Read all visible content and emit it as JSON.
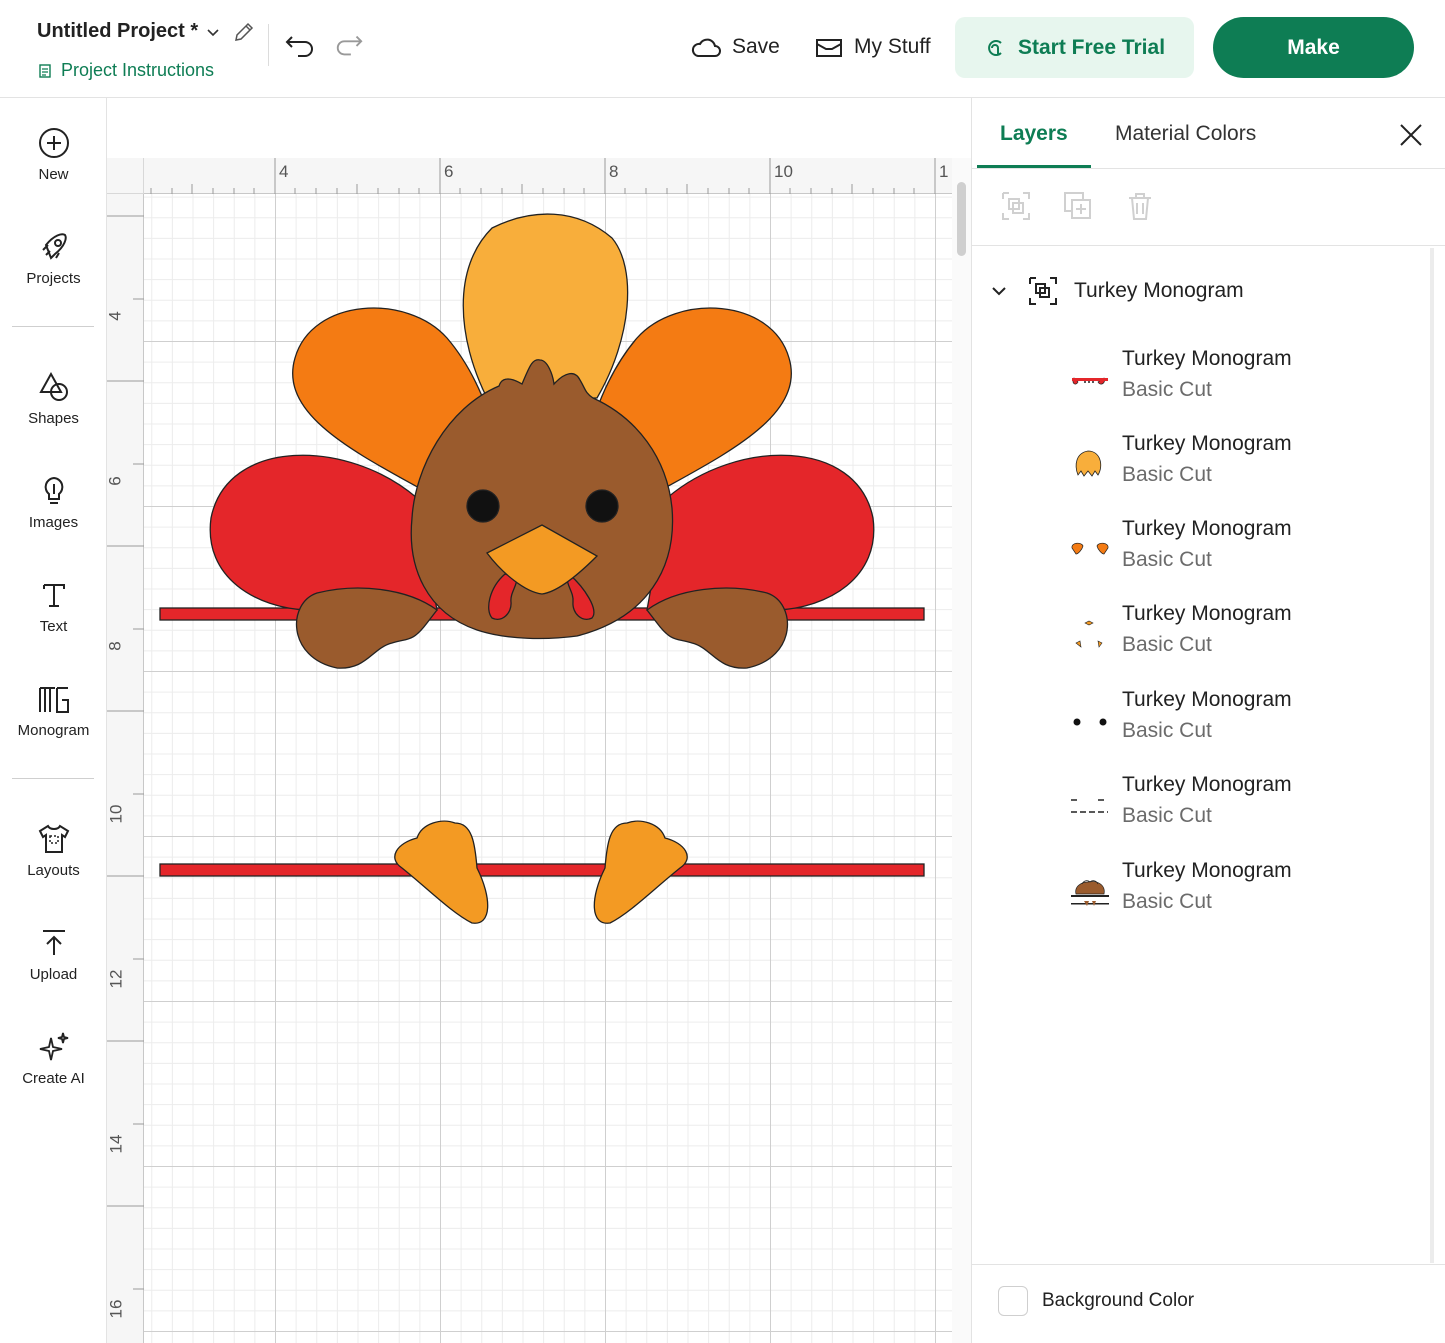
{
  "header": {
    "project_title": "Untitled Project *",
    "project_instructions": "Project Instructions",
    "save_label": "Save",
    "mystuff_label": "My Stuff",
    "trial_label": "Start Free Trial",
    "make_label": "Make"
  },
  "toolbar": {
    "items": [
      {
        "label": "New",
        "icon": "plus-circle-icon"
      },
      {
        "label": "Projects",
        "icon": "rocket-icon"
      },
      {
        "label": "Shapes",
        "icon": "shapes-icon"
      },
      {
        "label": "Images",
        "icon": "lightbulb-icon"
      },
      {
        "label": "Text",
        "icon": "text-icon"
      },
      {
        "label": "Monogram",
        "icon": "monogram-icon"
      },
      {
        "label": "Layouts",
        "icon": "tshirt-icon"
      },
      {
        "label": "Upload",
        "icon": "upload-icon"
      },
      {
        "label": "Create AI",
        "icon": "sparkle-icon"
      }
    ]
  },
  "canvas": {
    "hruler_labels": [
      "4",
      "6",
      "8",
      "10",
      "1"
    ],
    "vruler_labels": [
      "4",
      "6",
      "8",
      "10",
      "12",
      "14",
      "16"
    ],
    "artwork": "Turkey Monogram"
  },
  "panel": {
    "tab_layers": "Layers",
    "tab_material": "Material Colors",
    "group_name": "Turkey Monogram",
    "layers": [
      {
        "name": "Turkey Monogram",
        "type": "Basic Cut",
        "thumb": "red-wattles"
      },
      {
        "name": "Turkey Monogram",
        "type": "Basic Cut",
        "thumb": "yellow-feather"
      },
      {
        "name": "Turkey Monogram",
        "type": "Basic Cut",
        "thumb": "orange-feathers"
      },
      {
        "name": "Turkey Monogram",
        "type": "Basic Cut",
        "thumb": "beak-feet"
      },
      {
        "name": "Turkey Monogram",
        "type": "Basic Cut",
        "thumb": "eyes"
      },
      {
        "name": "Turkey Monogram",
        "type": "Basic Cut",
        "thumb": "bars"
      },
      {
        "name": "Turkey Monogram",
        "type": "Basic Cut",
        "thumb": "turkey-body"
      }
    ],
    "background_color_label": "Background Color"
  },
  "colors": {
    "brand": "#0e7d54",
    "red": "#e4262a",
    "orange": "#f47b13",
    "yellow": "#f8ae3b",
    "brown": "#9a5b2d",
    "beak": "#f39a23"
  }
}
